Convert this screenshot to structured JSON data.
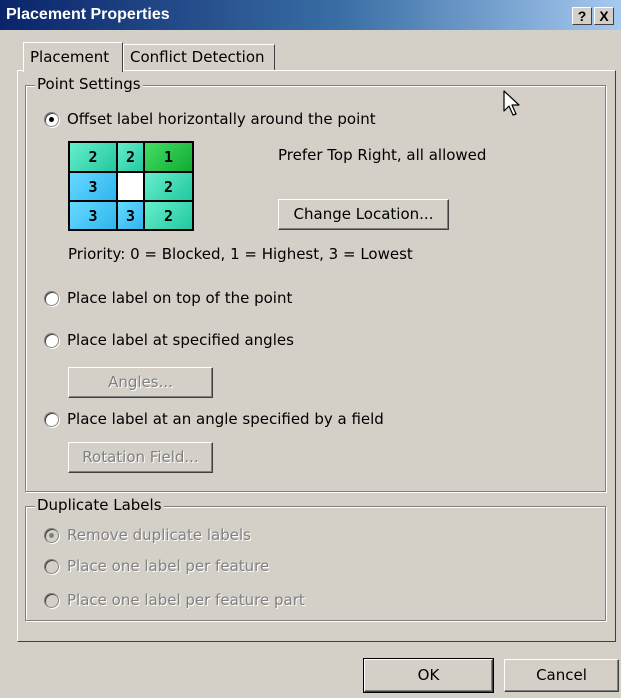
{
  "window": {
    "title": "Placement Properties"
  },
  "title_buttons": {
    "help": "?",
    "close": "X"
  },
  "tabs": [
    {
      "label": "Placement",
      "active": true
    },
    {
      "label": "Conflict Detection",
      "active": false
    }
  ],
  "point_settings": {
    "legend": "Point Settings",
    "options": [
      {
        "label": "Offset label horizontally around the point",
        "checked": true
      },
      {
        "label": "Place label on top of the point",
        "checked": false
      },
      {
        "label": "Place label at specified angles",
        "checked": false
      },
      {
        "label": "Place label at an angle specified by a field",
        "checked": false
      }
    ],
    "grid": [
      [
        "2",
        "2",
        "1"
      ],
      [
        "3",
        "",
        "2"
      ],
      [
        "3",
        "3",
        "2"
      ]
    ],
    "grid_description": "Prefer Top Right, all allowed",
    "change_location_label": "Change Location...",
    "priority_text": "Priority:  0 = Blocked, 1 = Highest, 3 = Lowest",
    "angles_label": "Angles...",
    "rotation_field_label": "Rotation Field..."
  },
  "duplicate_labels": {
    "legend": "Duplicate Labels",
    "options": [
      {
        "label": "Remove duplicate labels",
        "checked": true
      },
      {
        "label": "Place one label per feature",
        "checked": false
      },
      {
        "label": "Place one label per feature part",
        "checked": false
      }
    ]
  },
  "footer": {
    "ok_label": "OK",
    "cancel_label": "Cancel"
  },
  "colors": {
    "title_start": "#0a246a",
    "title_end": "#a6caf0",
    "face": "#d4d0c8"
  },
  "icons": {
    "cursor": "arrow-cursor-icon"
  }
}
